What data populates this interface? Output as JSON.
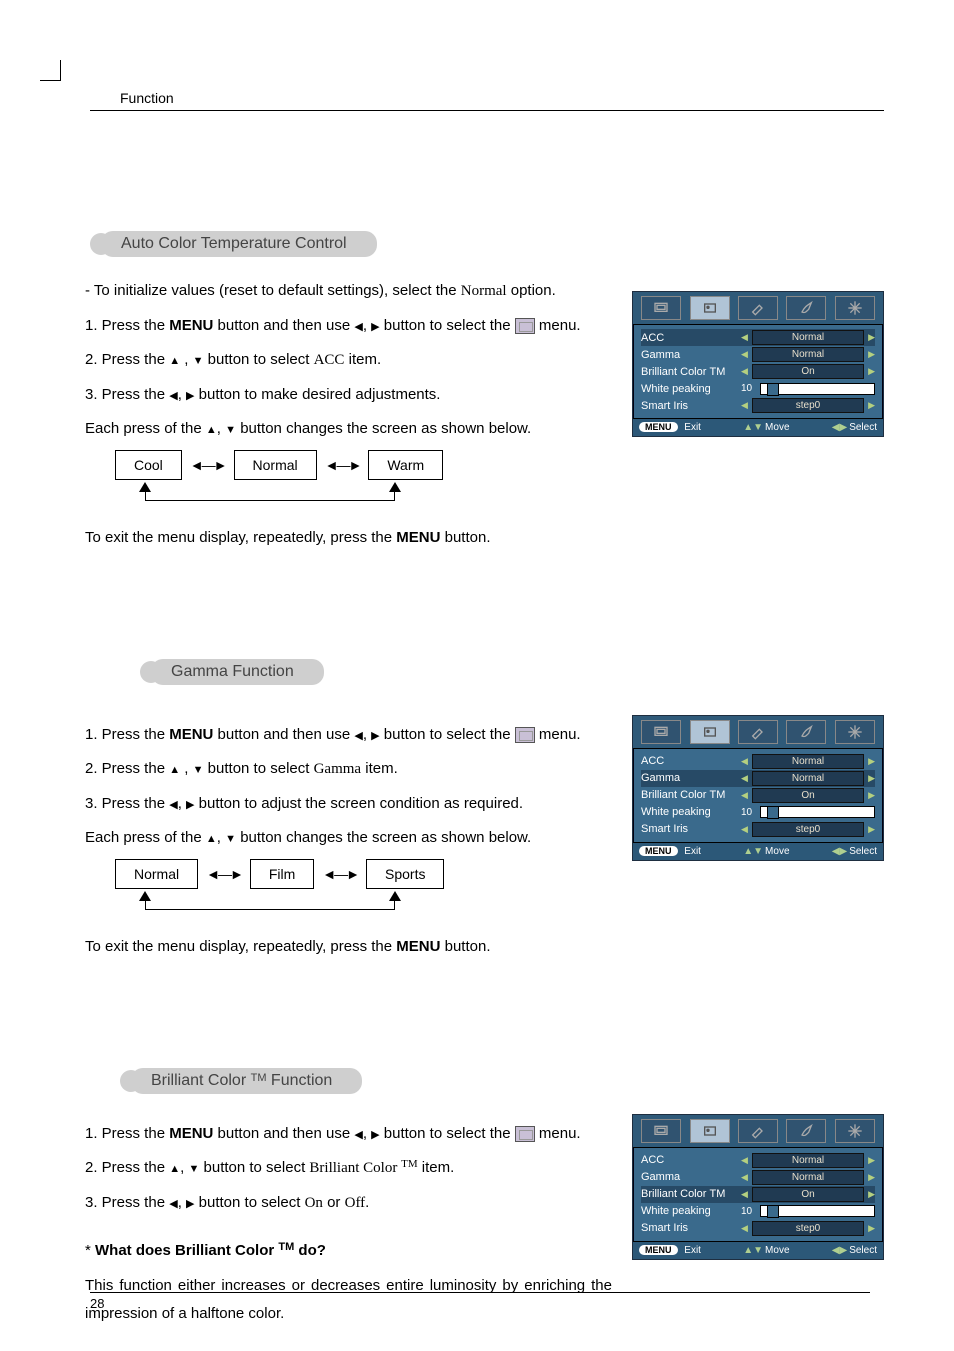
{
  "header": "Function",
  "page_number": "28",
  "sections": {
    "acc": {
      "title": "Auto Color Temperature Control",
      "note_prefix": "- To initialize values (reset to default settings), select the ",
      "note_option": "Normal",
      "note_suffix": " option.",
      "step1a": "1. Press the ",
      "step1b": "MENU",
      "step1c": " button and then use ",
      "step1d": " button to select the ",
      "step1e": " menu.",
      "step2a": "2. Press the  ",
      "step2b": " button to select ",
      "step2c": "ACC",
      "step2d": " item.",
      "step3a": "3. Press the ",
      "step3b": " button to make desired adjustments.",
      "eachpress_a": "Each press of the ",
      "eachpress_b": " button changes the screen as shown below.",
      "cycle": [
        "Cool",
        "Normal",
        "Warm"
      ],
      "exit_a": "To exit the menu display, repeatedly, press the ",
      "exit_b": "MENU",
      "exit_c": " button."
    },
    "gamma": {
      "title": "Gamma Function",
      "step1a": "1. Press the ",
      "step1b": "MENU",
      "step1c": " button and then use ",
      "step1d": " button to select the ",
      "step1e": " menu.",
      "step2a": "2. Press the  ",
      "step2b": " button to select ",
      "step2c": "Gamma",
      "step2d": " item.",
      "step3a": "3. Press the  ",
      "step3b": " button to adjust the screen condition as required.",
      "eachpress_a": "Each press of the ",
      "eachpress_b": " button changes the screen as shown below.",
      "cycle": [
        "Normal",
        "Film",
        "Sports"
      ],
      "exit_a": "To exit the menu display, repeatedly, press the ",
      "exit_b": "MENU",
      "exit_c": " button."
    },
    "brilliant": {
      "title_a": "Brilliant Color ",
      "title_tm": "TM",
      "title_b": " Function",
      "step1a": "1. Press the ",
      "step1b": "MENU",
      "step1c": " button and then use ",
      "step1d": " button to select the ",
      "step1e": " menu.",
      "step2a": "2. Press the ",
      "step2b": " button to select ",
      "step2c": "Brilliant Color ",
      "step2tm": "TM",
      "step2d": " item.",
      "step3a": "3. Press the ",
      "step3b": " button to select ",
      "step3c": "On",
      "step3d": " or ",
      "step3e": "Off",
      "step3f": ".",
      "what_q_star": "* ",
      "what_q_a": "What does Brilliant Color ",
      "what_q_tm": "TM",
      "what_q_b": " do?",
      "what_a": "This function either increases or decreases entire luminosity by enriching the impression of a halftone color."
    }
  },
  "osd": {
    "rows": {
      "acc": {
        "label": "ACC",
        "value": "Normal"
      },
      "gamma": {
        "label": "Gamma",
        "value": "Normal"
      },
      "brilliant": {
        "label_a": "Brilliant Color ",
        "label_tm": "TM",
        "value": "On"
      },
      "white": {
        "label": "White peaking",
        "value": "10"
      },
      "smart": {
        "label": "Smart Iris",
        "value": "step0"
      }
    },
    "footer": {
      "menu_btn": "MENU",
      "exit": "Exit",
      "move": "Move",
      "select": "Select"
    }
  }
}
